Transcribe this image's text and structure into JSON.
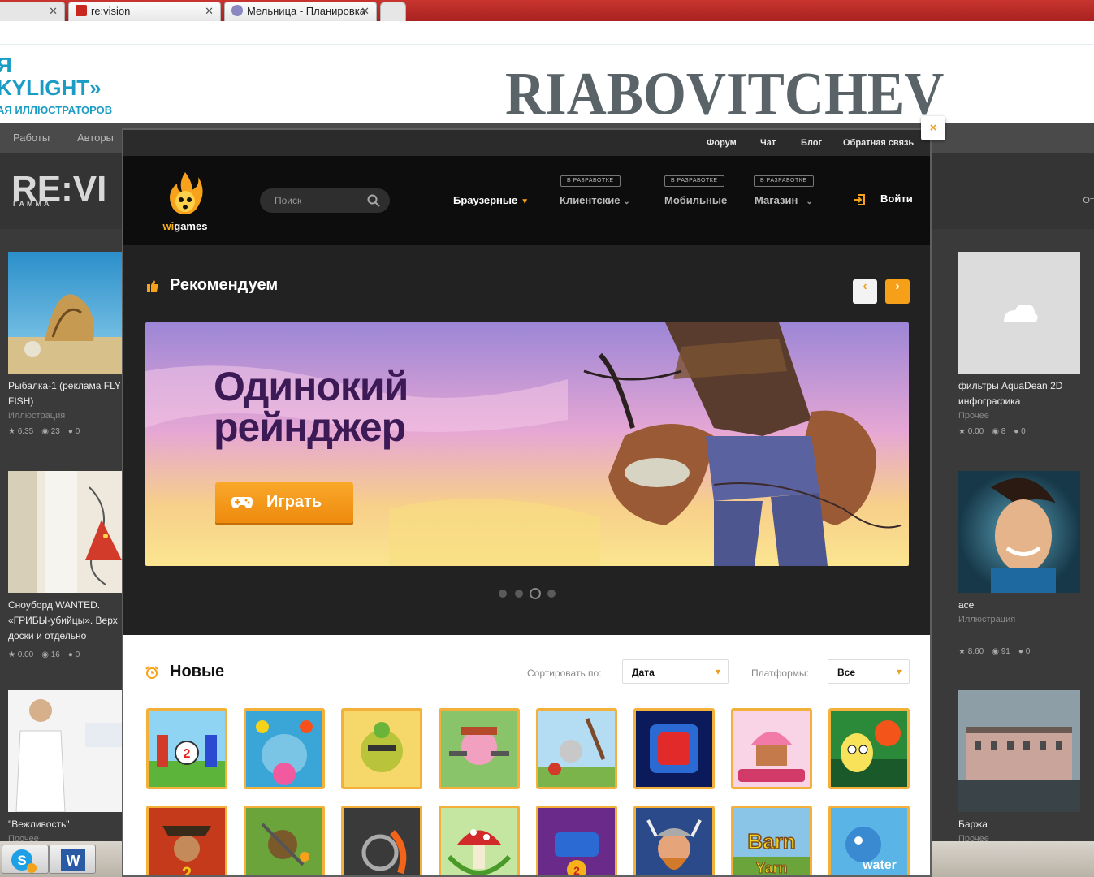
{
  "browser": {
    "tabs": [
      {
        "label": "",
        "faded": true
      },
      {
        "label": "re:vision"
      },
      {
        "label": "Мельница - Планировка"
      }
    ]
  },
  "background_site": {
    "banner_promo_lines": [
      "Я",
      "KYLIGHT»",
      "АЯ ИЛЛЮСТРАТОРОВ"
    ],
    "banner_title": "RIABOVITCHEV",
    "nav": [
      "Работы",
      "Авторы"
    ],
    "logo": "RE:VI",
    "logo_sub": "ГАММА",
    "right_link": "От",
    "cards_left": [
      {
        "title": "Рыбалка-1 (реклама FLY FISH)",
        "category": "Иллюстрация",
        "rating": "6.35",
        "views": "23",
        "comments": "0"
      },
      {
        "title": "Сноуборд WANTED. «ГРИБЫ-убийцы». Верх доски и отдельно",
        "category": "",
        "rating": "0.00",
        "views": "16",
        "comments": "0"
      },
      {
        "title": "\"Вежливость\"",
        "category": "Прочее",
        "rating": "",
        "views": "",
        "comments": ""
      }
    ],
    "cards_right": [
      {
        "title": "фильтры AquaDean 2D инфографика",
        "category": "Прочее",
        "rating": "0.00",
        "views": "8",
        "comments": "0"
      },
      {
        "title": "ace",
        "category": "Иллюстрация",
        "rating": "8.60",
        "views": "91",
        "comments": "0"
      },
      {
        "title": "Баржа",
        "category": "Прочее",
        "rating": "",
        "views": "",
        "comments": ""
      }
    ]
  },
  "modal": {
    "close": "×",
    "top_links": [
      "Форум",
      "Чат",
      "Блог",
      "Обратная связь"
    ],
    "logo_text": {
      "a": "wi",
      "b": "games"
    },
    "search_placeholder": "Поиск",
    "nav": [
      {
        "label": "Браузерные",
        "badge": "",
        "active": true
      },
      {
        "label": "Клиентские",
        "badge": "В РАЗРАБОТКЕ"
      },
      {
        "label": "Мобильные",
        "badge": "В РАЗРАБОТКЕ"
      },
      {
        "label": "Магазин",
        "badge": "В РАЗРАБОТКЕ"
      }
    ],
    "login": "Войти",
    "recommended": {
      "title": "Рекомендуем",
      "hero_title_line1": "Одинокий",
      "hero_title_line2": "рейнджер",
      "play_label": "Играть",
      "slides": 4,
      "active_slide": 3
    },
    "new_section": {
      "title": "Новые",
      "sort_label": "Сортировать по:",
      "sort_value": "Дата",
      "platform_label": "Платформы:",
      "platform_value": "Все"
    },
    "colors": {
      "accent": "#f6a01a",
      "hero_title": "#3b1a55"
    }
  }
}
